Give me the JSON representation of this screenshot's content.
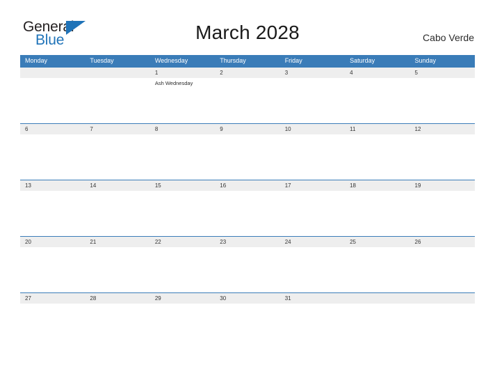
{
  "logo": {
    "word_top": "General",
    "word_bottom": "Blue",
    "triangle_color": "#1f73b8"
  },
  "header": {
    "title": "March 2028",
    "location": "Cabo Verde"
  },
  "colors": {
    "header_blue": "#3a7cb8",
    "date_strip_gray": "#eeeeee",
    "page_background": "#ffffff",
    "text_dark": "#231f20"
  },
  "calendar": {
    "weekdays": [
      "Monday",
      "Tuesday",
      "Wednesday",
      "Thursday",
      "Friday",
      "Saturday",
      "Sunday"
    ],
    "weeks": [
      {
        "days": [
          {
            "date": "",
            "events": []
          },
          {
            "date": "",
            "events": []
          },
          {
            "date": "1",
            "events": [
              "Ash Wednesday"
            ]
          },
          {
            "date": "2",
            "events": []
          },
          {
            "date": "3",
            "events": []
          },
          {
            "date": "4",
            "events": []
          },
          {
            "date": "5",
            "events": []
          }
        ]
      },
      {
        "days": [
          {
            "date": "6",
            "events": []
          },
          {
            "date": "7",
            "events": []
          },
          {
            "date": "8",
            "events": []
          },
          {
            "date": "9",
            "events": []
          },
          {
            "date": "10",
            "events": []
          },
          {
            "date": "11",
            "events": []
          },
          {
            "date": "12",
            "events": []
          }
        ]
      },
      {
        "days": [
          {
            "date": "13",
            "events": []
          },
          {
            "date": "14",
            "events": []
          },
          {
            "date": "15",
            "events": []
          },
          {
            "date": "16",
            "events": []
          },
          {
            "date": "17",
            "events": []
          },
          {
            "date": "18",
            "events": []
          },
          {
            "date": "19",
            "events": []
          }
        ]
      },
      {
        "days": [
          {
            "date": "20",
            "events": []
          },
          {
            "date": "21",
            "events": []
          },
          {
            "date": "22",
            "events": []
          },
          {
            "date": "23",
            "events": []
          },
          {
            "date": "24",
            "events": []
          },
          {
            "date": "25",
            "events": []
          },
          {
            "date": "26",
            "events": []
          }
        ]
      },
      {
        "days": [
          {
            "date": "27",
            "events": []
          },
          {
            "date": "28",
            "events": []
          },
          {
            "date": "29",
            "events": []
          },
          {
            "date": "30",
            "events": []
          },
          {
            "date": "31",
            "events": []
          },
          {
            "date": "",
            "events": []
          },
          {
            "date": "",
            "events": []
          }
        ]
      }
    ]
  }
}
